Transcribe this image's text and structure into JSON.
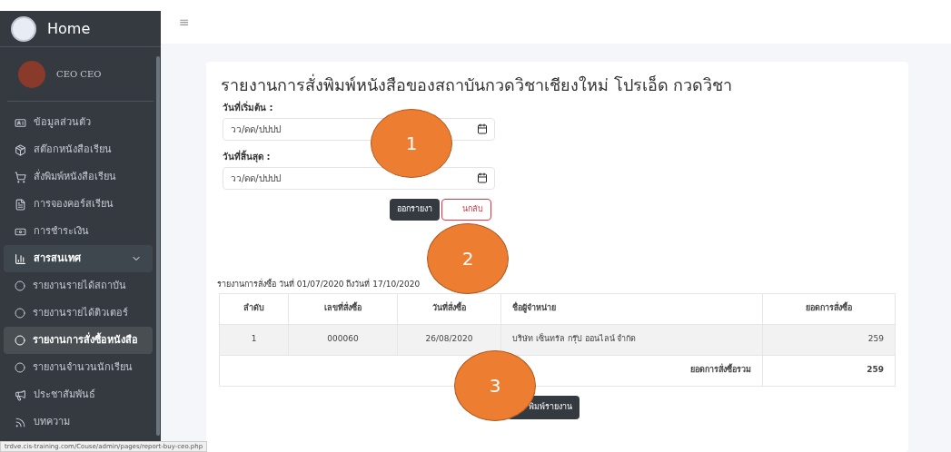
{
  "brand": {
    "title": "Home"
  },
  "user": {
    "name": "CEO CEO"
  },
  "sidebar": {
    "items": [
      {
        "kind": "icon",
        "label": "ข้อมูลส่วนตัว",
        "selected": false
      },
      {
        "kind": "icon",
        "label": "สต๊อกหนังสือเรียน",
        "selected": false
      },
      {
        "kind": "icon",
        "label": "สั่งพิมพ์หนังสือเรียน",
        "selected": false
      },
      {
        "kind": "icon",
        "label": "การจองคอร์สเรียน",
        "selected": false
      },
      {
        "kind": "icon",
        "label": "การชำระเงิน",
        "selected": false
      },
      {
        "kind": "group",
        "label": "สารสนเทศ",
        "expanded": true,
        "children": [
          {
            "label": "รายงานรายได้สถาบัน",
            "selected": false
          },
          {
            "label": "รายงานรายได้ติวเตอร์",
            "selected": false
          },
          {
            "label": "รายงานการสั่งซื้อหนังสือ",
            "selected": true
          },
          {
            "label": "รายงานจำนวนนักเรียน",
            "selected": false
          }
        ]
      },
      {
        "kind": "icon",
        "label": "ประชาสัมพันธ์",
        "selected": false
      },
      {
        "kind": "icon",
        "label": "บทความ",
        "selected": false
      }
    ]
  },
  "topbar": {
    "menu_glyph": "≡"
  },
  "report": {
    "title": "รายงานการสั่งพิมพ์หนังสือของสถาบันกวดวิชาเชียงใหม่ โปรเอ็ด กวดวิชา",
    "fields": [
      {
        "label": "วันที่เริ่มต้น :",
        "placeholder": "วว/ดด/ปปปป"
      },
      {
        "label": "วันที่สิ้นสุด :",
        "placeholder": "วว/ดด/ปปปป"
      }
    ],
    "buttons": [
      {
        "kind": "primary",
        "label": "ออกรายงา"
      },
      {
        "kind": "outline",
        "label": "นกลับ"
      }
    ],
    "caption": "รายงานการสั่งซื้อ วันที่ 01/07/2020 ถึงวันที่ 17/10/2020",
    "table": {
      "columns": [
        "ลำดับ",
        "เลขที่สั่งซื้อ",
        "วันที่สั่งซื้อ",
        "ชื่อผู้จำหน่าย",
        "ยอดการสั่งซื้อ"
      ],
      "rows": [
        [
          "1",
          "000060",
          "26/08/2020",
          "บริษัท เซ็นทรัล กรุ๊ป ออนไลน์ จำกัด",
          "259"
        ]
      ],
      "total_label": "ยอดการสั่งซื้อรวม",
      "total": "259"
    },
    "print_button": "พิมพ์รายงาน"
  },
  "callouts": [
    "1",
    "2",
    "3"
  ],
  "status_bar": "trdve.cis-training.com/Couse/admin/pages/report-buy-ceo.php"
}
